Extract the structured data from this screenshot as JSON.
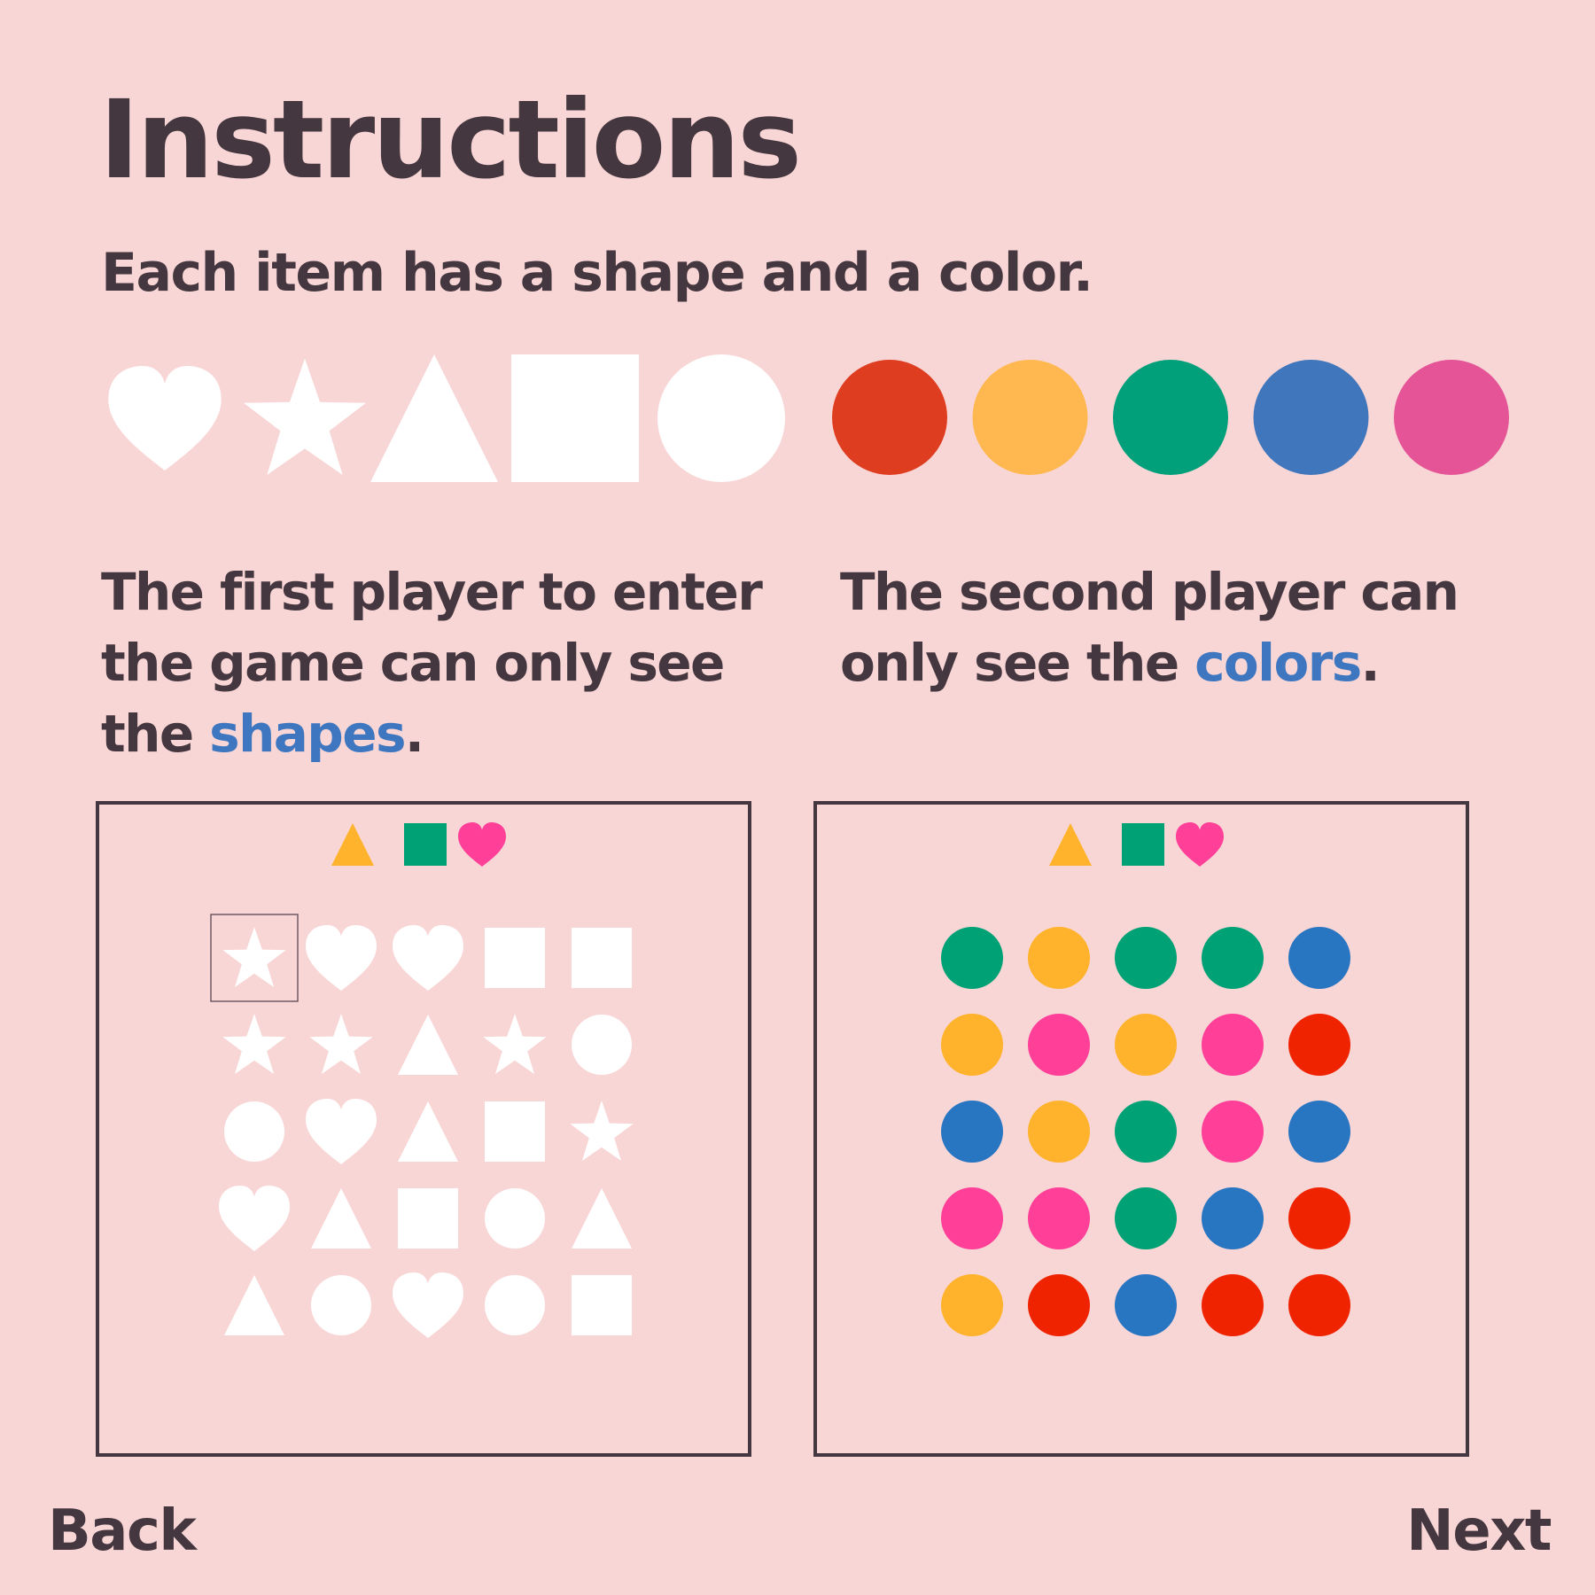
{
  "title": "Instructions",
  "subtitle": "Each item has a shape and a color.",
  "legend": {
    "shapes": [
      "heart",
      "star",
      "triangle",
      "square",
      "circle"
    ],
    "shape_color": "#ffffff",
    "colors": [
      "#de3d20",
      "#ffb84f",
      "#01a07a",
      "#4077bc",
      "#e45496"
    ]
  },
  "player1": {
    "text_line1": "The first player to enter",
    "text_line2": "the game can only see",
    "text_pre": "the ",
    "text_highlight": "shapes",
    "text_post": "."
  },
  "player2": {
    "text_line1": "The second player can",
    "text_pre": "only see the ",
    "text_highlight": "colors",
    "text_post": "."
  },
  "target": [
    {
      "shape": "triangle",
      "color": "#ffb22c"
    },
    {
      "shape": "square",
      "color": "#00a175"
    },
    {
      "shape": "heart",
      "color": "#ff3f98"
    }
  ],
  "board": {
    "rows": 5,
    "cols": 5,
    "selected_index": 0,
    "shapes": [
      "star",
      "heart",
      "heart",
      "square",
      "square",
      "star",
      "star",
      "triangle",
      "star",
      "circle",
      "circle",
      "heart",
      "triangle",
      "square",
      "star",
      "heart",
      "triangle",
      "square",
      "circle",
      "triangle",
      "triangle",
      "circle",
      "heart",
      "circle",
      "square"
    ],
    "colors": [
      "#00a175",
      "#ffb22c",
      "#00a175",
      "#00a175",
      "#2875c2",
      "#ffb22c",
      "#ff3f98",
      "#ffb22c",
      "#ff3f98",
      "#ef2300",
      "#2875c2",
      "#ffb22c",
      "#00a175",
      "#ff3f98",
      "#2875c2",
      "#ff3f98",
      "#ff3f98",
      "#00a175",
      "#2875c2",
      "#ef2300",
      "#ffb22c",
      "#ef2300",
      "#2875c2",
      "#ef2300",
      "#ef2300"
    ]
  },
  "nav": {
    "back": "Back",
    "next": "Next"
  }
}
